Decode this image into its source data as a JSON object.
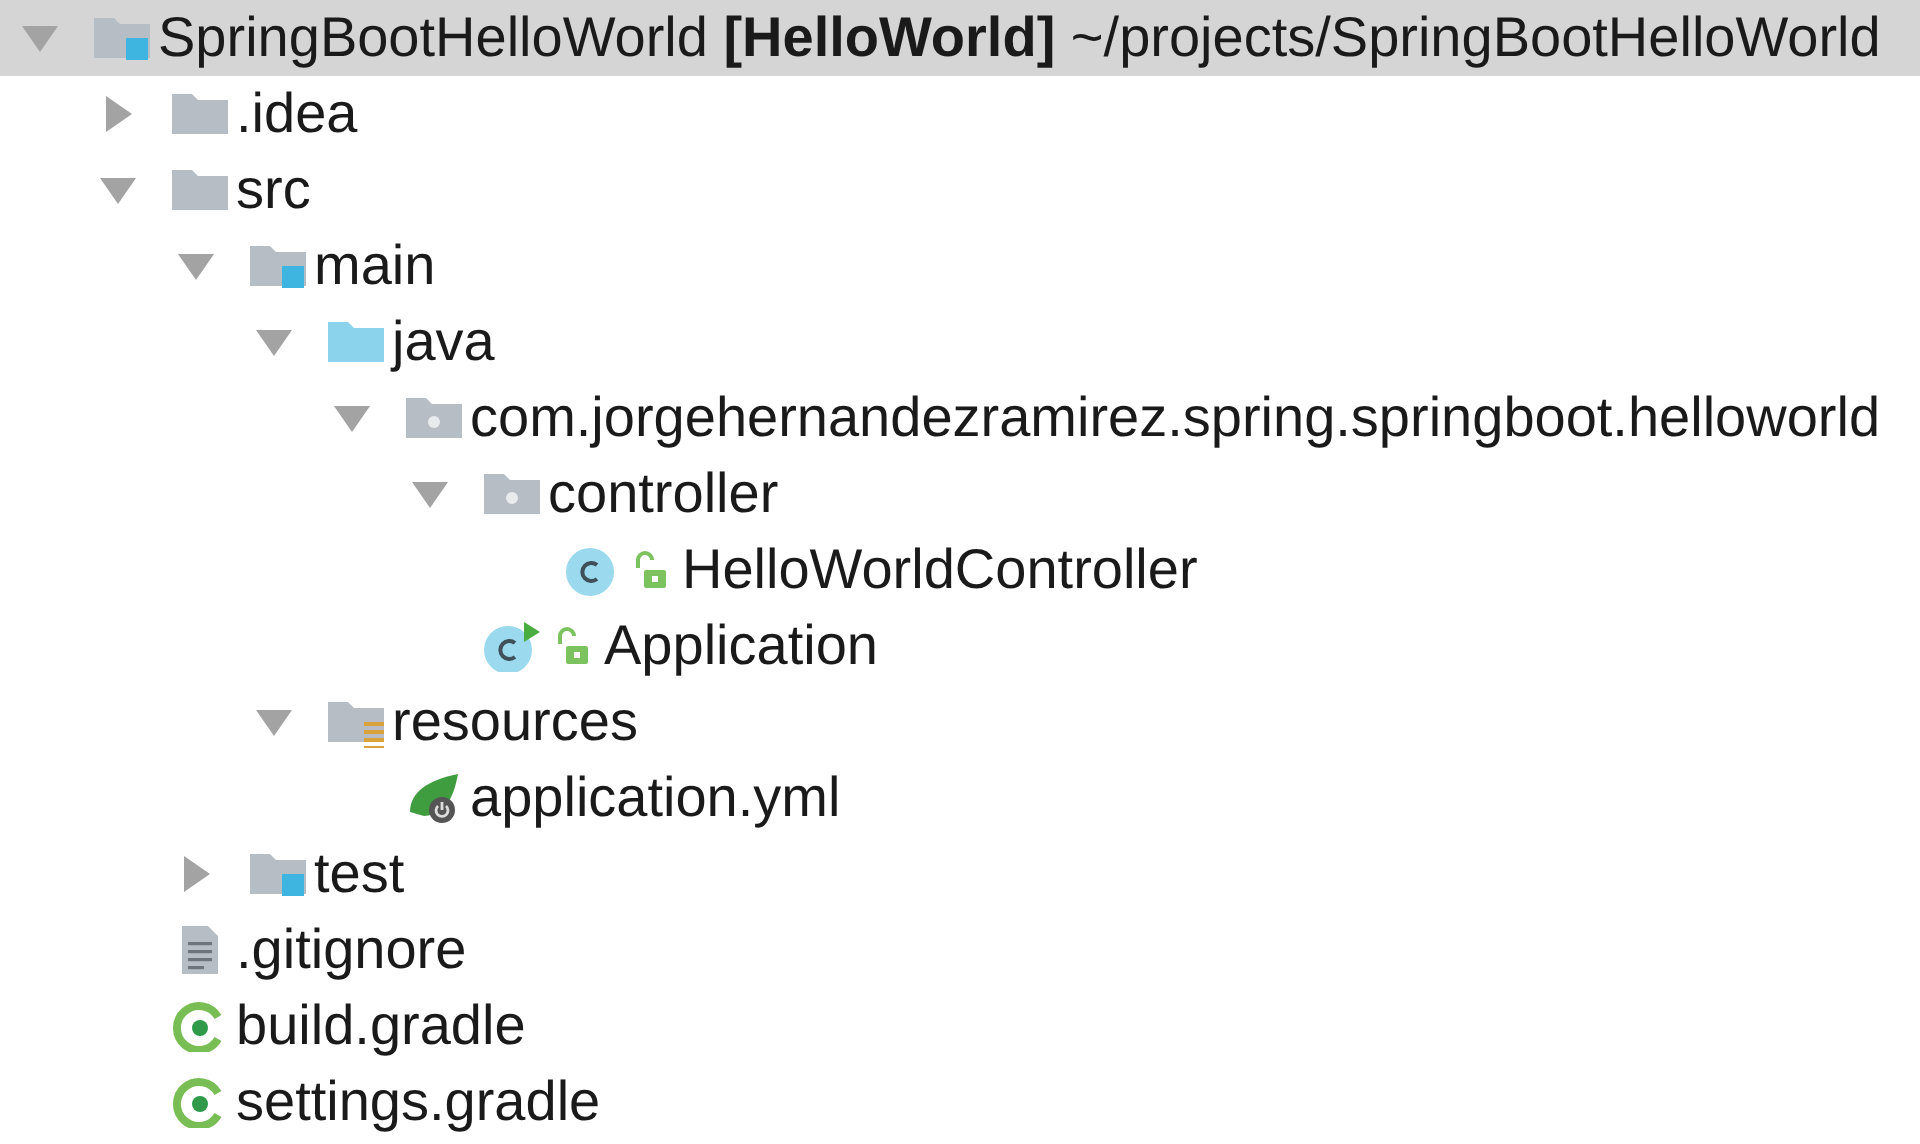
{
  "project_tree": [
    {
      "label": "SpringBootHelloWorld **[HelloWorld]** ~/projects/SpringBootHelloWorld",
      "kind": "folder-blue-mark",
      "expanded": true,
      "selected": true,
      "children": [
        {
          "label": ".idea",
          "kind": "folder",
          "expanded": false,
          "selected": false
        },
        {
          "label": "src",
          "kind": "folder",
          "expanded": true,
          "selected": false,
          "children": [
            {
              "label": "main",
              "kind": "folder-blue-mark",
              "expanded": true,
              "selected": false,
              "children": [
                {
                  "label": "java",
                  "kind": "folder-blue",
                  "expanded": true,
                  "selected": false,
                  "children": [
                    {
                      "label": "com.jorgehernandezramirez.spring.springboot.helloworld",
                      "kind": "folder-dot",
                      "expanded": true,
                      "selected": false,
                      "children": [
                        {
                          "label": "controller",
                          "kind": "folder-dot",
                          "expanded": true,
                          "selected": false,
                          "children": [
                            {
                              "label": "HelloWorldController",
                              "kind": "class",
                              "public": true,
                              "selected": false
                            }
                          ]
                        },
                        {
                          "label": "Application",
                          "kind": "class-run",
                          "public": true,
                          "selected": false
                        }
                      ]
                    }
                  ]
                },
                {
                  "label": "resources",
                  "kind": "folder-lines",
                  "expanded": true,
                  "selected": false,
                  "children": [
                    {
                      "label": "application.yml",
                      "kind": "spring-file",
                      "selected": false
                    }
                  ]
                }
              ]
            },
            {
              "label": "test",
              "kind": "folder-blue-mark",
              "expanded": false,
              "selected": false
            }
          ]
        },
        {
          "label": ".gitignore",
          "kind": "text-file",
          "selected": false
        },
        {
          "label": "build.gradle",
          "kind": "gradle",
          "selected": false
        },
        {
          "label": "settings.gradle",
          "kind": "gradle",
          "selected": false
        }
      ]
    }
  ]
}
